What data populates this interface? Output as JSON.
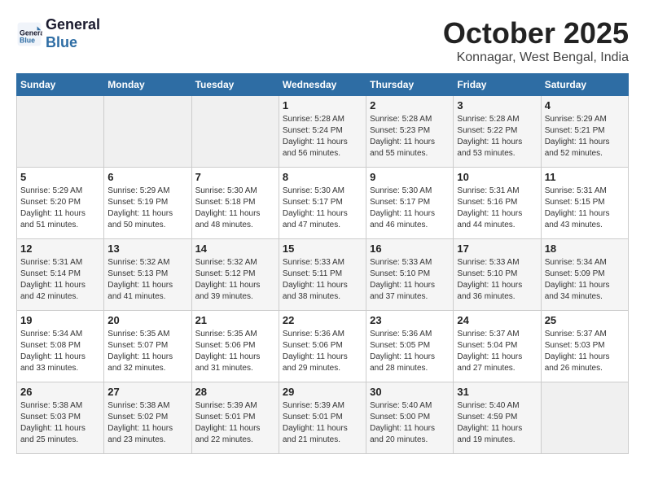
{
  "header": {
    "logo_line1": "General",
    "logo_line2": "Blue",
    "month_year": "October 2025",
    "location": "Konnagar, West Bengal, India"
  },
  "weekdays": [
    "Sunday",
    "Monday",
    "Tuesday",
    "Wednesday",
    "Thursday",
    "Friday",
    "Saturday"
  ],
  "weeks": [
    [
      {
        "day": "",
        "info": ""
      },
      {
        "day": "",
        "info": ""
      },
      {
        "day": "",
        "info": ""
      },
      {
        "day": "1",
        "info": "Sunrise: 5:28 AM\nSunset: 5:24 PM\nDaylight: 11 hours and 56 minutes."
      },
      {
        "day": "2",
        "info": "Sunrise: 5:28 AM\nSunset: 5:23 PM\nDaylight: 11 hours and 55 minutes."
      },
      {
        "day": "3",
        "info": "Sunrise: 5:28 AM\nSunset: 5:22 PM\nDaylight: 11 hours and 53 minutes."
      },
      {
        "day": "4",
        "info": "Sunrise: 5:29 AM\nSunset: 5:21 PM\nDaylight: 11 hours and 52 minutes."
      }
    ],
    [
      {
        "day": "5",
        "info": "Sunrise: 5:29 AM\nSunset: 5:20 PM\nDaylight: 11 hours and 51 minutes."
      },
      {
        "day": "6",
        "info": "Sunrise: 5:29 AM\nSunset: 5:19 PM\nDaylight: 11 hours and 50 minutes."
      },
      {
        "day": "7",
        "info": "Sunrise: 5:30 AM\nSunset: 5:18 PM\nDaylight: 11 hours and 48 minutes."
      },
      {
        "day": "8",
        "info": "Sunrise: 5:30 AM\nSunset: 5:17 PM\nDaylight: 11 hours and 47 minutes."
      },
      {
        "day": "9",
        "info": "Sunrise: 5:30 AM\nSunset: 5:17 PM\nDaylight: 11 hours and 46 minutes."
      },
      {
        "day": "10",
        "info": "Sunrise: 5:31 AM\nSunset: 5:16 PM\nDaylight: 11 hours and 44 minutes."
      },
      {
        "day": "11",
        "info": "Sunrise: 5:31 AM\nSunset: 5:15 PM\nDaylight: 11 hours and 43 minutes."
      }
    ],
    [
      {
        "day": "12",
        "info": "Sunrise: 5:31 AM\nSunset: 5:14 PM\nDaylight: 11 hours and 42 minutes."
      },
      {
        "day": "13",
        "info": "Sunrise: 5:32 AM\nSunset: 5:13 PM\nDaylight: 11 hours and 41 minutes."
      },
      {
        "day": "14",
        "info": "Sunrise: 5:32 AM\nSunset: 5:12 PM\nDaylight: 11 hours and 39 minutes."
      },
      {
        "day": "15",
        "info": "Sunrise: 5:33 AM\nSunset: 5:11 PM\nDaylight: 11 hours and 38 minutes."
      },
      {
        "day": "16",
        "info": "Sunrise: 5:33 AM\nSunset: 5:10 PM\nDaylight: 11 hours and 37 minutes."
      },
      {
        "day": "17",
        "info": "Sunrise: 5:33 AM\nSunset: 5:10 PM\nDaylight: 11 hours and 36 minutes."
      },
      {
        "day": "18",
        "info": "Sunrise: 5:34 AM\nSunset: 5:09 PM\nDaylight: 11 hours and 34 minutes."
      }
    ],
    [
      {
        "day": "19",
        "info": "Sunrise: 5:34 AM\nSunset: 5:08 PM\nDaylight: 11 hours and 33 minutes."
      },
      {
        "day": "20",
        "info": "Sunrise: 5:35 AM\nSunset: 5:07 PM\nDaylight: 11 hours and 32 minutes."
      },
      {
        "day": "21",
        "info": "Sunrise: 5:35 AM\nSunset: 5:06 PM\nDaylight: 11 hours and 31 minutes."
      },
      {
        "day": "22",
        "info": "Sunrise: 5:36 AM\nSunset: 5:06 PM\nDaylight: 11 hours and 29 minutes."
      },
      {
        "day": "23",
        "info": "Sunrise: 5:36 AM\nSunset: 5:05 PM\nDaylight: 11 hours and 28 minutes."
      },
      {
        "day": "24",
        "info": "Sunrise: 5:37 AM\nSunset: 5:04 PM\nDaylight: 11 hours and 27 minutes."
      },
      {
        "day": "25",
        "info": "Sunrise: 5:37 AM\nSunset: 5:03 PM\nDaylight: 11 hours and 26 minutes."
      }
    ],
    [
      {
        "day": "26",
        "info": "Sunrise: 5:38 AM\nSunset: 5:03 PM\nDaylight: 11 hours and 25 minutes."
      },
      {
        "day": "27",
        "info": "Sunrise: 5:38 AM\nSunset: 5:02 PM\nDaylight: 11 hours and 23 minutes."
      },
      {
        "day": "28",
        "info": "Sunrise: 5:39 AM\nSunset: 5:01 PM\nDaylight: 11 hours and 22 minutes."
      },
      {
        "day": "29",
        "info": "Sunrise: 5:39 AM\nSunset: 5:01 PM\nDaylight: 11 hours and 21 minutes."
      },
      {
        "day": "30",
        "info": "Sunrise: 5:40 AM\nSunset: 5:00 PM\nDaylight: 11 hours and 20 minutes."
      },
      {
        "day": "31",
        "info": "Sunrise: 5:40 AM\nSunset: 4:59 PM\nDaylight: 11 hours and 19 minutes."
      },
      {
        "day": "",
        "info": ""
      }
    ]
  ]
}
